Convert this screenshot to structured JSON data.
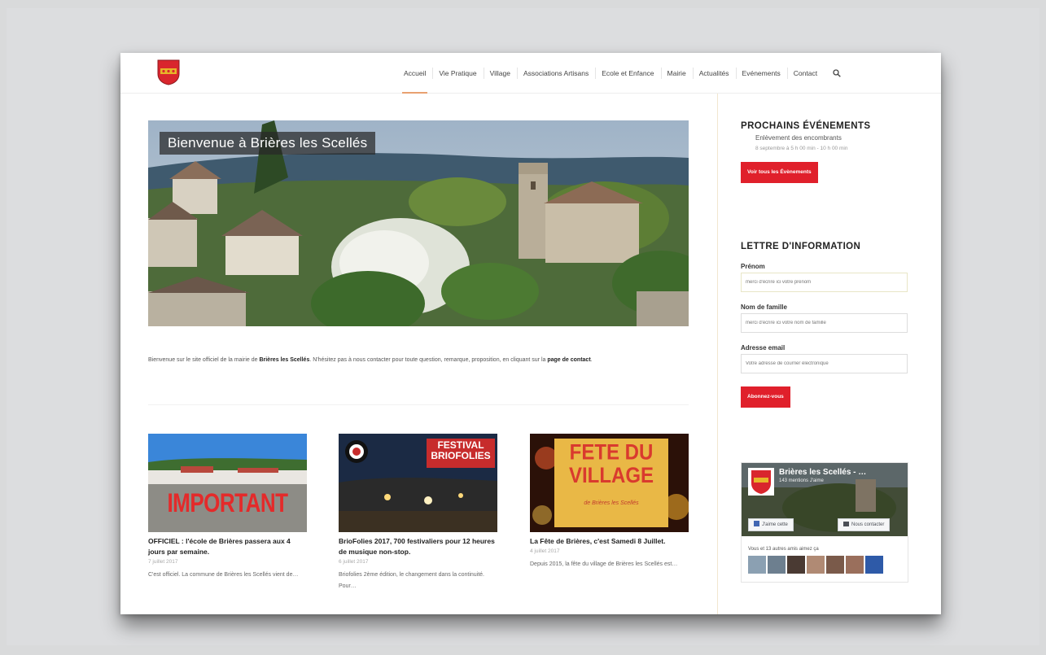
{
  "site": {
    "hero_title": "Bienvenue à Brières les Scellés"
  },
  "nav": {
    "items": [
      "Accueil",
      "Vie Pratique",
      "Village",
      "Associations Artisans",
      "Ecole et Enfance",
      "Mairie",
      "Actualités",
      "Evénements",
      "Contact"
    ],
    "active_index": 0
  },
  "intro": {
    "prefix": "Bienvenue sur le site officiel de la mairie de ",
    "bold": "Brières les Scellés",
    "middle": ". N'hésitez pas à nous contacter pour toute question, remarque, proposition, en cliquant sur la ",
    "link": "page de contact",
    "suffix": "."
  },
  "posts": [
    {
      "thumb_text": "IMPORTANT",
      "title": "OFFICIEL : l'école de Brières passera aux 4 jours par semaine.",
      "date": "7 juillet 2017",
      "excerpt": "C'est officiel. La commune de Brières les Scellés vient de…"
    },
    {
      "thumb_text": "FESTIVAL BRIOFOLIES",
      "title": "BrioFolies 2017, 700 festivaliers pour 12 heures de musique non-stop.",
      "date": "6 juillet 2017",
      "excerpt": "Briofolies 2ème édition, le changement dans la continuité. Pour…"
    },
    {
      "thumb_text": "FETE DU VILLAGE",
      "thumb_sub": "de Brières les Scellés",
      "title": "La Fête de Brières, c'est Samedi 8 Juillet.",
      "date": "4 juillet 2017",
      "excerpt": "Depuis 2015, la fête du village de Brières les Scellés est…"
    }
  ],
  "sidebar": {
    "events_heading": "PROCHAINS ÉVÉNEMENTS",
    "event_title": "Enlèvement des encombrants",
    "event_date": "8 septembre à 5 h 00 min - 10 h 00 min",
    "events_button": "Voir tous les Évènements",
    "newsletter_heading": "LETTRE D'INFORMATION",
    "fields": [
      {
        "label": "Prénom",
        "placeholder": "merci d'écrire ici votre prénom"
      },
      {
        "label": "Nom de famille",
        "placeholder": "merci d'écrire ici votre nom de famille"
      },
      {
        "label": "Adresse email",
        "placeholder": "Votre adresse de courrier électronique"
      }
    ],
    "subscribe_button": "Abonnez-vous"
  },
  "facebook": {
    "page_name": "Brières les Scellés - …",
    "count": "143 mentions J'aime",
    "like_button": "J'aime cette",
    "contact_button": "Nous contacter",
    "friends_text": "Vous et 13 autres amis aimez ça"
  },
  "colors": {
    "accent_red": "#e0202b",
    "nav_underline": "#e8a170",
    "coat_of_arms": "#d9262d"
  }
}
